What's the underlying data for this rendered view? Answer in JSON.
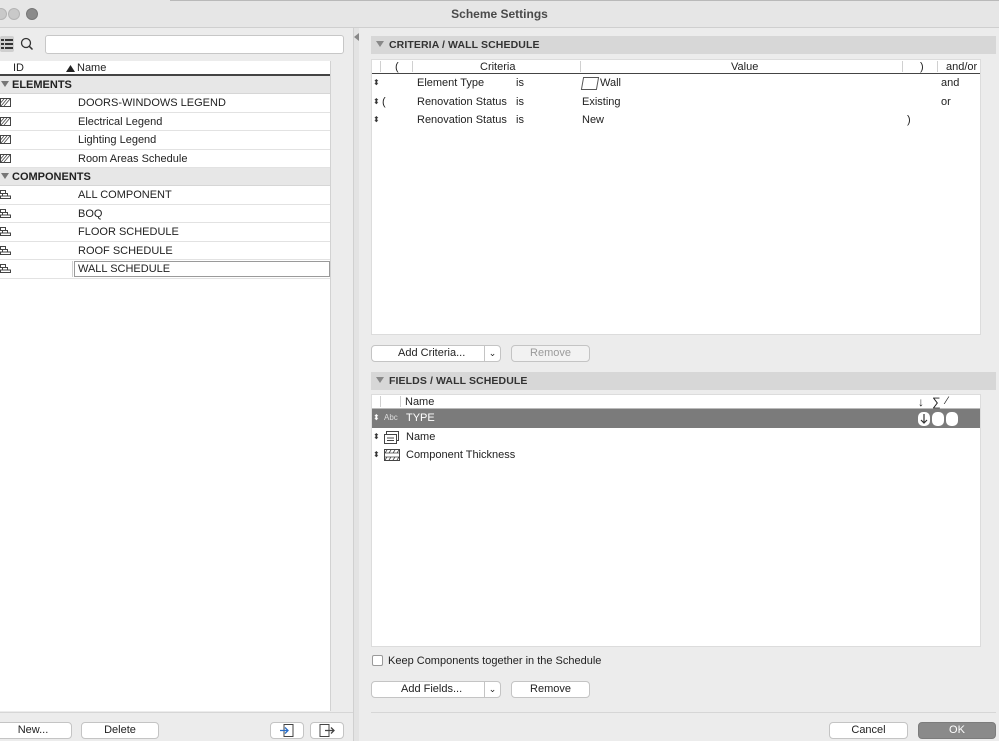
{
  "window": {
    "title": "Scheme Settings"
  },
  "left": {
    "search_placeholder": "",
    "columns": {
      "id": "ID",
      "name": "Name"
    },
    "groups": [
      {
        "label": "ELEMENTS",
        "items": [
          "DOORS-WINDOWS LEGEND",
          "Electrical Legend",
          "Lighting Legend",
          "Room Areas Schedule"
        ]
      },
      {
        "label": "COMPONENTS",
        "items": [
          "ALL COMPONENT",
          "BOQ",
          "FLOOR SCHEDULE",
          "ROOF SCHEDULE",
          "WALL SCHEDULE"
        ]
      }
    ],
    "buttons": {
      "new": "New...",
      "delete": "Delete"
    }
  },
  "criteria": {
    "header": "CRITERIA /  WALL SCHEDULE",
    "columns": {
      "open": "(",
      "criteria": "Criteria",
      "value": "Value",
      "close": ")",
      "andor": "and/or"
    },
    "rows": [
      {
        "open": "",
        "criteria": "Element Type",
        "op": "is",
        "value": "Wall",
        "close": "",
        "andor": "and"
      },
      {
        "open": "(",
        "criteria": "Renovation Status",
        "op": "is",
        "value": "Existing",
        "close": "",
        "andor": "or"
      },
      {
        "open": "",
        "criteria": "Renovation Status",
        "op": "is",
        "value": "New",
        "close": ")",
        "andor": ""
      }
    ],
    "add_label": "Add Criteria...",
    "remove_label": "Remove"
  },
  "fields": {
    "header": "FIELDS /  WALL SCHEDULE",
    "column_name": "Name",
    "column_icons": {
      "sort": "↓",
      "sum": "∑",
      "flag": "⁄"
    },
    "rows": [
      {
        "type_icon": "Abc",
        "name": "TYPE"
      },
      {
        "type_icon": "name-icon",
        "name": "Name"
      },
      {
        "type_icon": "thickness-icon",
        "name": "Component Thickness"
      }
    ],
    "keep_components_label": "Keep Components together in the Schedule",
    "add_label": "Add Fields...",
    "remove_label": "Remove"
  },
  "footer": {
    "cancel": "Cancel",
    "ok": "OK"
  }
}
